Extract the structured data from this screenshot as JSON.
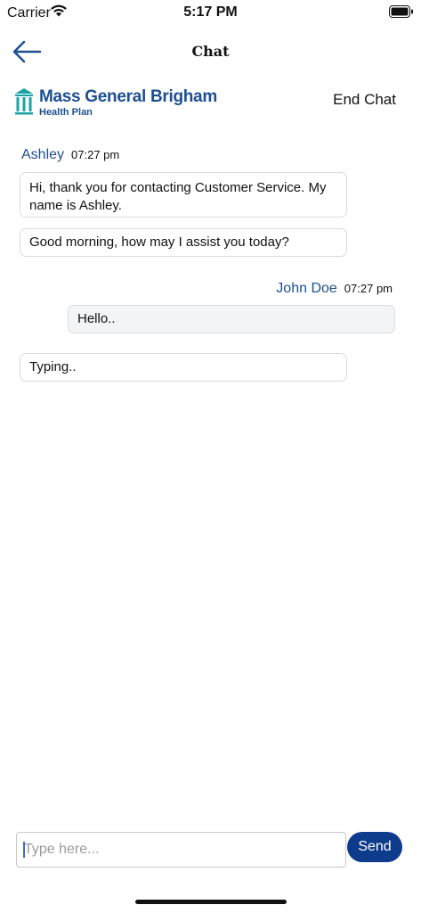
{
  "status_bar": {
    "carrier": "Carrier",
    "time": "5:17 PM"
  },
  "nav": {
    "title": "Chat",
    "back_icon": "arrow-left-icon"
  },
  "brand": {
    "name": "Mass General Brigham",
    "sub": "Health Plan",
    "color": "#1d4f91",
    "mark_color": "#1aa3a6"
  },
  "end_chat_label": "End Chat",
  "messages": [
    {
      "sender": "Ashley",
      "time": "07:27 pm",
      "bubbles": [
        "Hi, thank you for contacting Customer Service. My name is Ashley.",
        "Good morning, how may I assist you today?"
      ]
    },
    {
      "sender": "John Doe",
      "time": "07:27 pm",
      "bubbles": [
        "Hello.."
      ]
    }
  ],
  "typing_indicator": "Typing..",
  "composer": {
    "placeholder": "Type here...",
    "send_label": "Send",
    "send_color": "#0e3b8c"
  }
}
